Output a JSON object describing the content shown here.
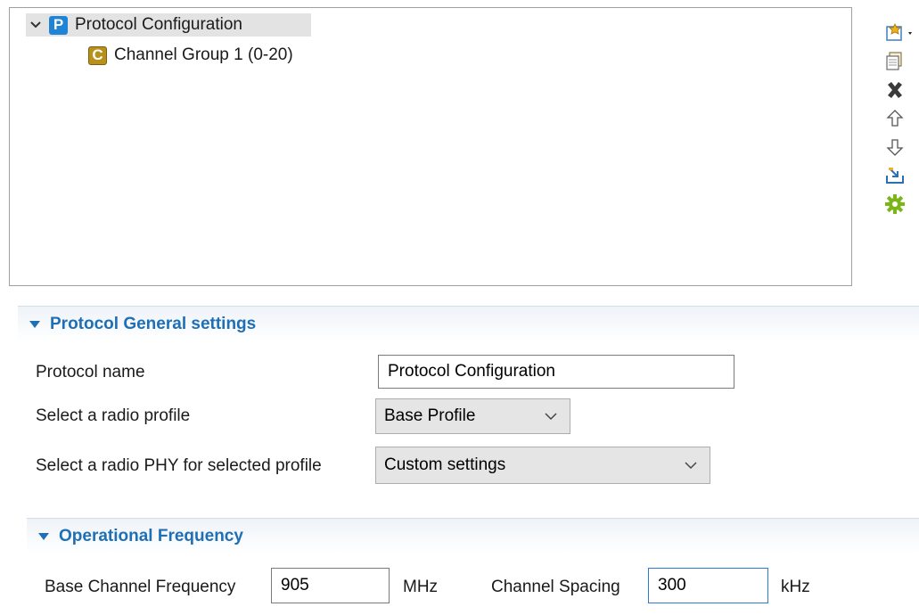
{
  "tree": {
    "root": {
      "badge": "P",
      "label": "Protocol Configuration"
    },
    "child": {
      "badge": "C",
      "label": "Channel Group 1 (0-20)"
    }
  },
  "toolbar": {
    "items": [
      "new-item-icon",
      "copy-icon",
      "delete-icon",
      "move-up-icon",
      "move-down-icon",
      "import-icon",
      "settings-gear-icon"
    ]
  },
  "general": {
    "title": "Protocol General settings",
    "protocol_name_label": "Protocol name",
    "protocol_name_value": "Protocol Configuration",
    "radio_profile_label": "Select a radio profile",
    "radio_profile_value": "Base Profile",
    "phy_label": "Select a radio PHY for selected profile",
    "phy_value": "Custom settings"
  },
  "frequency": {
    "title": "Operational Frequency",
    "base_label": "Base Channel Frequency",
    "base_value": "905",
    "base_unit": "MHz",
    "spacing_label": "Channel Spacing",
    "spacing_value": "300",
    "spacing_unit": "kHz"
  },
  "colors": {
    "accent": "#1f6fb5",
    "protocol_badge": "#1f84d6",
    "channel_badge": "#b8901c",
    "gear": "#7cb518"
  }
}
